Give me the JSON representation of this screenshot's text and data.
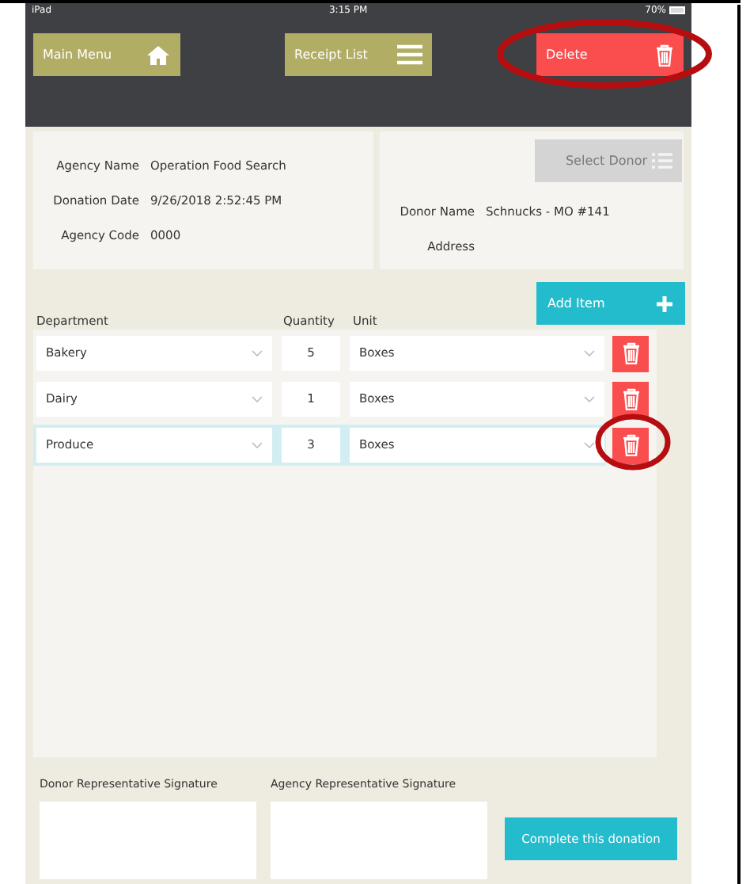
{
  "status_bar": {
    "device": "iPad",
    "time": "3:15 PM",
    "battery": "70%"
  },
  "toolbar": [
    {
      "label": "Main Menu",
      "kind": "home"
    },
    {
      "label": "Receipt List",
      "kind": "list"
    },
    {
      "label": "Delete",
      "kind": "delete"
    }
  ],
  "agency": [
    {
      "label": "Agency Name",
      "value": "Operation Food Search"
    },
    {
      "label": "Donation Date",
      "value": "9/26/2018 2:52:45 PM"
    },
    {
      "label": "Agency Code",
      "value": "0000"
    }
  ],
  "donor": {
    "button": {
      "label": "Select Donor",
      "disabled": true
    },
    "fields": [
      {
        "label": "Donor Name",
        "value": "Schnucks - MO #141"
      },
      {
        "label": "Address"
      }
    ]
  },
  "add_item": "Add Item",
  "columns": [
    "Department",
    "Quantity",
    "Unit"
  ],
  "items": [
    {
      "department": "Bakery",
      "quantity": "5",
      "unit": "Boxes",
      "selected": false
    },
    {
      "department": "Dairy",
      "quantity": "1",
      "unit": "Boxes",
      "selected": false
    },
    {
      "department": "Produce",
      "quantity": "3",
      "unit": "Boxes",
      "selected": true
    }
  ],
  "signatures": [
    "Donor Representative Signature",
    "Agency Representative Signature"
  ],
  "complete_button": "Complete this donation"
}
